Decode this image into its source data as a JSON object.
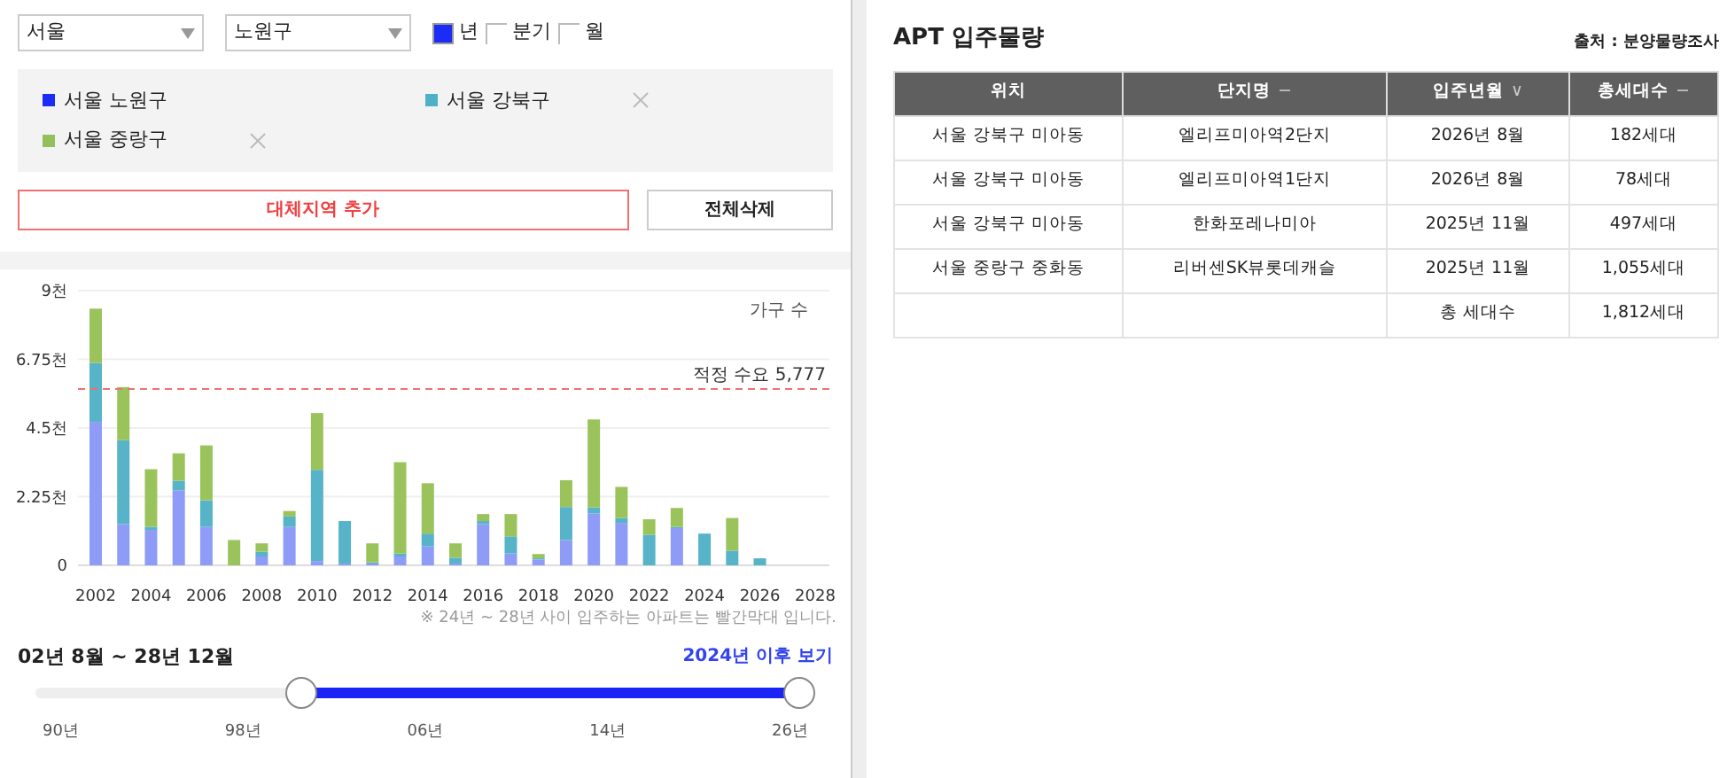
{
  "filters": {
    "city": "서울",
    "district": "노원구",
    "periods": [
      {
        "label": "년",
        "checked": true
      },
      {
        "label": "분기",
        "checked": false
      },
      {
        "label": "월",
        "checked": false
      }
    ]
  },
  "regions": [
    {
      "label": "서울 노원구",
      "color": "#1a2cf5",
      "removable": false
    },
    {
      "label": "서울 강북구",
      "color": "#4fb0c6",
      "removable": true
    },
    {
      "label": "서울 중랑구",
      "color": "#93c05a",
      "removable": true
    }
  ],
  "buttons": {
    "add": "대체지역 추가",
    "clear": "전체삭제"
  },
  "chart_data": {
    "type": "bar",
    "stacked": true,
    "ylabel": "가구 수",
    "categories": [
      "2002",
      null,
      "2004",
      null,
      "2006",
      null,
      "2008",
      null,
      "2010",
      null,
      "2012",
      null,
      "2014",
      null,
      "2016",
      null,
      "2018",
      null,
      "2020",
      null,
      "2022",
      null,
      "2024",
      null,
      "2026",
      null,
      "2028"
    ],
    "series": [
      {
        "color": "#8e9cf7",
        "values": [
          4.7,
          1.35,
          1.16,
          2.46,
          1.26,
          0,
          0.29,
          1.26,
          0.14,
          0.06,
          0.06,
          0.29,
          0.62,
          0.06,
          1.35,
          0.39,
          0.19,
          0.83,
          1.7,
          1.39,
          0,
          1.22,
          0,
          0,
          0,
          null,
          null
        ]
      },
      {
        "color": "#56b3c8",
        "values": [
          1.93,
          2.75,
          0.1,
          0.31,
          0.87,
          0,
          0.16,
          0.34,
          2.99,
          1.39,
          0.04,
          0.1,
          0.42,
          0.19,
          0.1,
          0.56,
          0.04,
          1.08,
          0.2,
          0.16,
          1.0,
          0.04,
          1.04,
          0.48,
          0.23,
          null,
          null
        ]
      },
      {
        "color": "#9bc35c",
        "values": [
          1.78,
          1.74,
          1.89,
          0.9,
          1.8,
          0.83,
          0.27,
          0.18,
          1.86,
          0,
          0.62,
          2.99,
          1.65,
          0.47,
          0.23,
          0.73,
          0.14,
          0.88,
          2.88,
          1.02,
          0.51,
          0.62,
          0,
          1.07,
          0,
          null,
          null
        ]
      }
    ],
    "ylim": [
      0,
      9
    ],
    "yticks": [
      {
        "value": 0,
        "label": "0"
      },
      {
        "value": 2.25,
        "label": "2.25천"
      },
      {
        "value": 4.5,
        "label": "4.5천"
      },
      {
        "value": 6.75,
        "label": "6.75천"
      },
      {
        "value": 9,
        "label": "9천"
      }
    ],
    "grid": true,
    "ref_lines": [
      {
        "axis": "y",
        "value": 5.777,
        "color": "#f07070",
        "label": "적정 수요 5,777"
      }
    ]
  },
  "note": "※ 24년 ~ 28년 사이 입주하는 아파트는 빨간막대 입니다.",
  "range": {
    "label": "02년 8월 ~ 28년 12월",
    "link": "2024년 이후 보기",
    "thumbs": [
      {
        "level": 0.34
      },
      {
        "level": 0.98
      }
    ],
    "ticks": [
      "90년",
      "98년",
      "06년",
      "14년",
      "26년"
    ]
  },
  "panel": {
    "title": "APT 입주물량",
    "source": "출처 : 분양물량조사"
  },
  "table": {
    "columns": [
      {
        "label": "위치"
      },
      {
        "label": "단지명",
        "sort_mark": "−"
      },
      {
        "label": "입주년월",
        "sort_mark": "∨"
      },
      {
        "label": "총세대수",
        "sort_mark": "−"
      }
    ],
    "rows": [
      [
        "서울 강북구 미아동",
        "엘리프미아역2단지",
        "2026년 8월",
        "182세대"
      ],
      [
        "서울 강북구 미아동",
        "엘리프미아역1단지",
        "2026년 8월",
        "78세대"
      ],
      [
        "서울 강북구 미아동",
        "한화포레나미아",
        "2025년 11월",
        "497세대"
      ],
      [
        "서울 중랑구 중화동",
        "리버센SK뷰롯데캐슬",
        "2025년 11월",
        "1,055세대"
      ]
    ],
    "total": {
      "label": "총 세대수",
      "value": "1,812세대"
    }
  }
}
